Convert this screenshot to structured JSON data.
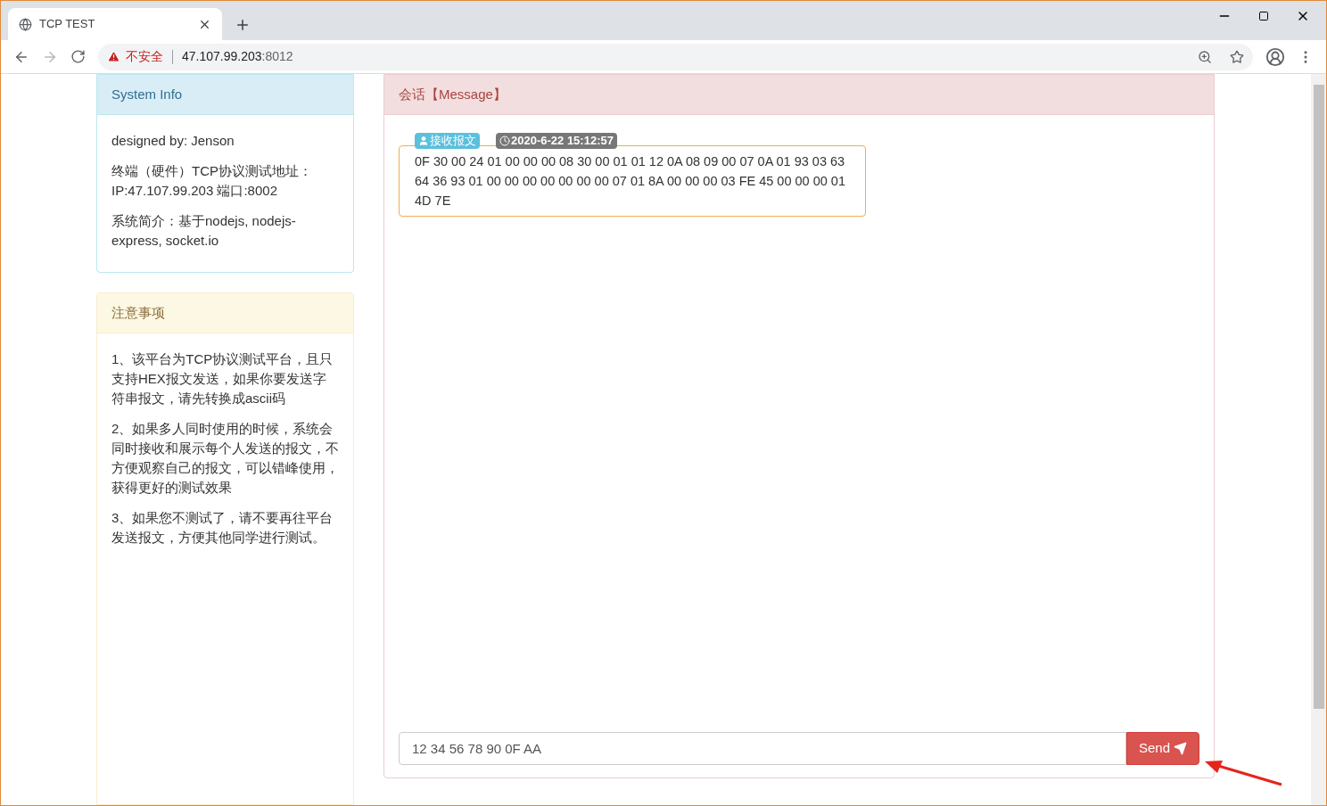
{
  "browser": {
    "tab_title": "TCP TEST",
    "security_label": "不安全",
    "url_host": "47.107.99.203",
    "url_port": ":8012"
  },
  "system_info": {
    "title": "System Info",
    "lines": [
      "designed by: Jenson",
      "终端（硬件）TCP协议测试地址：IP:47.107.99.203 端口:8002",
      "系统简介：基于nodejs, nodejs-express, socket.io"
    ]
  },
  "notes": {
    "title": "注意事项",
    "lines": [
      "1、该平台为TCP协议测试平台，且只支持HEX报文发送，如果你要发送字符串报文，请先转换成ascii码",
      "2、如果多人同时使用的时候，系统会同时接收和展示每个人发送的报文，不方便观察自己的报文，可以错峰使用，获得更好的测试效果",
      "3、如果您不测试了，请不要再往平台发送报文，方便其他同学进行测试。"
    ]
  },
  "session": {
    "title": "会话【Message】",
    "messages": [
      {
        "kind": "received",
        "tag": "接收报文",
        "time": "2020-6-22 15:12:57",
        "body": "0F 30 00 24 01 00 00 00 08 30 00 01 01 12 0A 08 09 00 07 0A 01 93 03 63 64 36 93 01 00 00 00 00 00 00 00 07 01 8A 00 00 00 03 FE 45 00 00 00 01 4D 7E"
      }
    ],
    "input_value": "12 34 56 78 90 0F AA",
    "send_label": "Send"
  }
}
